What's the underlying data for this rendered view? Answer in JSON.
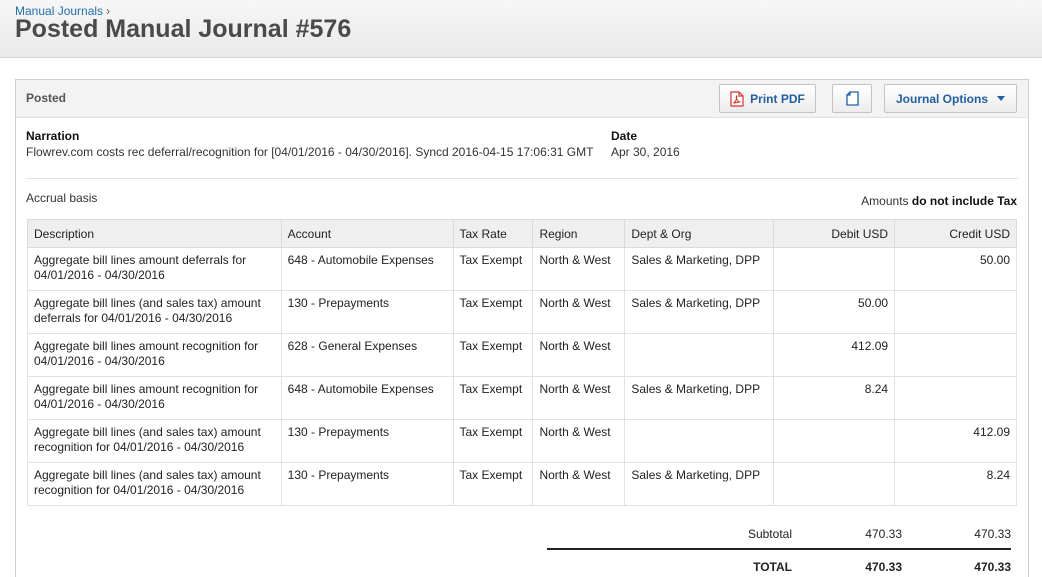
{
  "breadcrumb": {
    "parent": "Manual Journals",
    "separator": "›"
  },
  "title": "Posted Manual Journal #576",
  "panel": {
    "status": "Posted",
    "print_pdf_label": "Print PDF",
    "journal_options_label": "Journal Options"
  },
  "meta": {
    "narration_label": "Narration",
    "narration_value": "Flowrev.com costs rec deferral/recognition for [04/01/2016 - 04/30/2016]. Syncd 2016-04-15 17:06:31 GMT",
    "date_label": "Date",
    "date_value": "Apr 30, 2016"
  },
  "basis": "Accrual basis",
  "amounts_note": {
    "prefix": "Amounts",
    "emphasis": "do not include Tax"
  },
  "table": {
    "headers": {
      "description": "Description",
      "account": "Account",
      "tax_rate": "Tax Rate",
      "region": "Region",
      "dept": "Dept & Org",
      "debit": "Debit USD",
      "credit": "Credit USD"
    },
    "rows": [
      {
        "description": "Aggregate bill lines amount deferrals for 04/01/2016 - 04/30/2016",
        "account": "648 - Automobile Expenses",
        "tax_rate": "Tax Exempt",
        "region": "North & West",
        "dept": "Sales & Marketing, DPP",
        "debit": "",
        "credit": "50.00"
      },
      {
        "description": "Aggregate bill lines (and sales tax) amount deferrals for 04/01/2016 - 04/30/2016",
        "account": "130 - Prepayments",
        "tax_rate": "Tax Exempt",
        "region": "North & West",
        "dept": "Sales & Marketing, DPP",
        "debit": "50.00",
        "credit": ""
      },
      {
        "description": "Aggregate bill lines amount recognition for 04/01/2016 - 04/30/2016",
        "account": "628 - General Expenses",
        "tax_rate": "Tax Exempt",
        "region": "North & West",
        "dept": "",
        "debit": "412.09",
        "credit": ""
      },
      {
        "description": "Aggregate bill lines amount recognition for 04/01/2016 - 04/30/2016",
        "account": "648 - Automobile Expenses",
        "tax_rate": "Tax Exempt",
        "region": "North & West",
        "dept": "Sales & Marketing, DPP",
        "debit": "8.24",
        "credit": ""
      },
      {
        "description": "Aggregate bill lines (and sales tax) amount recognition for 04/01/2016 - 04/30/2016",
        "account": "130 - Prepayments",
        "tax_rate": "Tax Exempt",
        "region": "North & West",
        "dept": "",
        "debit": "",
        "credit": "412.09"
      },
      {
        "description": "Aggregate bill lines (and sales tax) amount recognition for 04/01/2016 - 04/30/2016",
        "account": "130 - Prepayments",
        "tax_rate": "Tax Exempt",
        "region": "North & West",
        "dept": "Sales & Marketing, DPP",
        "debit": "",
        "credit": "8.24"
      }
    ]
  },
  "totals": {
    "subtotal_label": "Subtotal",
    "subtotal_debit": "470.33",
    "subtotal_credit": "470.33",
    "total_label": "TOTAL",
    "total_debit": "470.33",
    "total_credit": "470.33"
  },
  "colors": {
    "link": "#1f6fb5",
    "button_text": "#1f5fa8",
    "pdf_icon": "#d9322c"
  },
  "icons": {
    "pdf": "pdf-file-icon",
    "copy": "copy-document-icon",
    "dropdown": "chevron-down-icon"
  }
}
